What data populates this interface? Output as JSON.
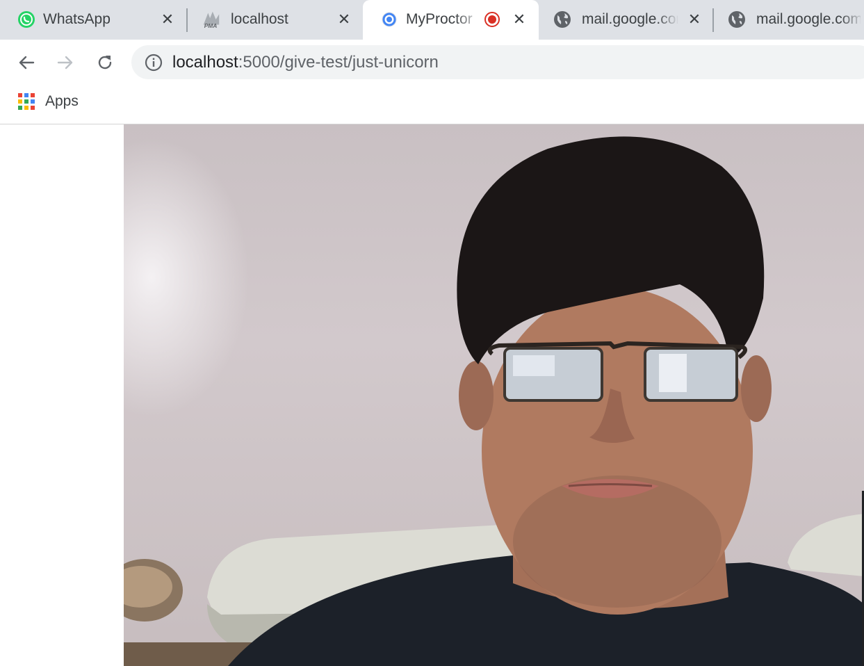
{
  "tabs": [
    {
      "title": "WhatsApp",
      "icon": "whatsapp-icon"
    },
    {
      "title": "localhost",
      "icon": "phpmyadmin-icon"
    },
    {
      "title": "MyProctor",
      "icon": "chrome-app-icon",
      "recording": true,
      "active": true
    },
    {
      "title": "mail.google.com",
      "icon": "globe-icon"
    },
    {
      "title": "mail.google.com",
      "icon": "globe-icon"
    }
  ],
  "address": {
    "host": "localhost",
    "path": ":5000/give-test/just-unicorn"
  },
  "bookmarks": {
    "apps_label": "Apps"
  },
  "colors": {
    "tabstrip": "#dee1e6",
    "omnibox": "#f1f3f4",
    "recording": "#d93025",
    "whatsapp": "#25d366"
  }
}
